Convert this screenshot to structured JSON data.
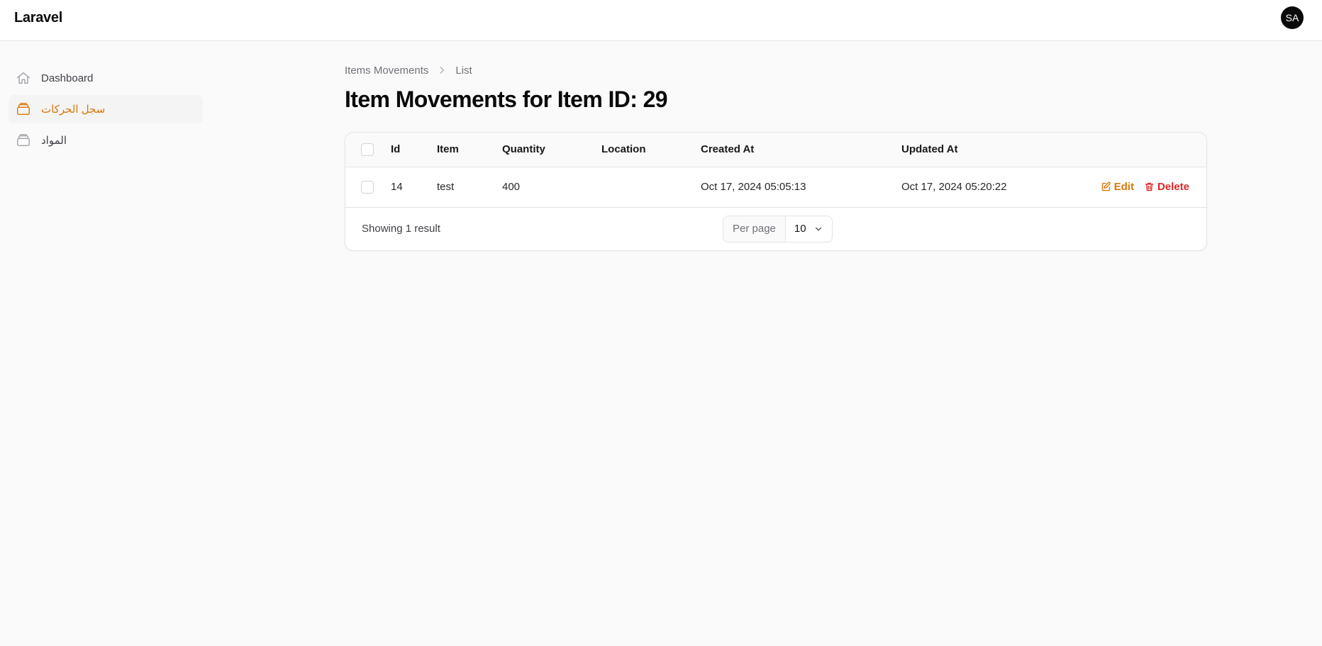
{
  "app": {
    "brand": "Laravel",
    "user_initials": "SA"
  },
  "colors": {
    "accent": "#d97706",
    "danger": "#dc2626",
    "background": "#fafafa"
  },
  "sidebar": {
    "items": [
      {
        "label": "Dashboard",
        "icon": "home-icon",
        "active": false
      },
      {
        "label": "سجل الحركات",
        "icon": "archive-icon",
        "active": true
      },
      {
        "label": "المواد",
        "icon": "archive-icon",
        "active": false
      }
    ]
  },
  "breadcrumb": {
    "parent": "Items Movements",
    "current": "List"
  },
  "page": {
    "title": "Item Movements for Item ID: 29"
  },
  "table": {
    "columns": [
      "Id",
      "Item",
      "Quantity",
      "Location",
      "Created At",
      "Updated At"
    ],
    "rows": [
      {
        "id": "14",
        "item": "test",
        "quantity": "400",
        "location": "",
        "created_at": "Oct 17, 2024 05:05:13",
        "updated_at": "Oct 17, 2024 05:20:22"
      }
    ],
    "actions": {
      "edit": "Edit",
      "delete": "Delete"
    }
  },
  "pagination": {
    "showing": "Showing 1 result",
    "per_page_label": "Per page",
    "per_page_value": "10"
  }
}
